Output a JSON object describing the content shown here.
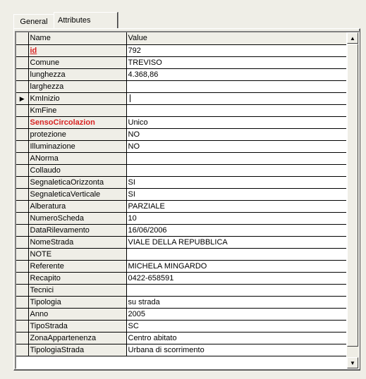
{
  "tabs": [
    {
      "label": "General",
      "active": false
    },
    {
      "label": "Attributes",
      "active": true
    }
  ],
  "grid": {
    "columns": [
      "Name",
      "Value"
    ],
    "current_row": 4,
    "rows": [
      {
        "name": "id",
        "value": "792",
        "style": "key"
      },
      {
        "name": "Comune",
        "value": "TREVISO",
        "style": ""
      },
      {
        "name": "lunghezza",
        "value": "4.368,86",
        "style": ""
      },
      {
        "name": "larghezza",
        "value": "",
        "style": ""
      },
      {
        "name": "KmInizio",
        "value": "",
        "style": ""
      },
      {
        "name": "KmFine",
        "value": "",
        "style": ""
      },
      {
        "name": "SensoCircolazion",
        "value": "Unico",
        "style": "req"
      },
      {
        "name": "protezione",
        "value": "NO",
        "style": ""
      },
      {
        "name": "Illuminazione",
        "value": "NO",
        "style": ""
      },
      {
        "name": "ANorma",
        "value": "",
        "style": ""
      },
      {
        "name": "Collaudo",
        "value": "",
        "style": ""
      },
      {
        "name": "SegnaleticaOrizzonta",
        "value": "SI",
        "style": ""
      },
      {
        "name": "SegnaleticaVerticale",
        "value": "SI",
        "style": ""
      },
      {
        "name": "Alberatura",
        "value": "PARZIALE",
        "style": ""
      },
      {
        "name": "NumeroScheda",
        "value": "10",
        "style": ""
      },
      {
        "name": "DataRilevamento",
        "value": "16/06/2006",
        "style": ""
      },
      {
        "name": "NomeStrada",
        "value": "VIALE DELLA REPUBBLICA",
        "style": ""
      },
      {
        "name": "NOTE",
        "value": "",
        "style": ""
      },
      {
        "name": "Referente",
        "value": "MICHELA MINGARDO",
        "style": ""
      },
      {
        "name": "Recapito",
        "value": "0422-658591",
        "style": ""
      },
      {
        "name": "Tecnici",
        "value": "",
        "style": ""
      },
      {
        "name": "Tipologia",
        "value": "su strada",
        "style": ""
      },
      {
        "name": "Anno",
        "value": "2005",
        "style": ""
      },
      {
        "name": "TipoStrada",
        "value": "SC",
        "style": ""
      },
      {
        "name": "ZonaAppartenenza",
        "value": "Centro abitato",
        "style": ""
      },
      {
        "name": "TipologiaStrada",
        "value": "Urbana di scorrimento",
        "style": ""
      }
    ]
  },
  "icons": {
    "row_indicator": "triangle-right-icon",
    "scroll_up": "arrow-up-icon",
    "scroll_down": "arrow-down-icon"
  }
}
